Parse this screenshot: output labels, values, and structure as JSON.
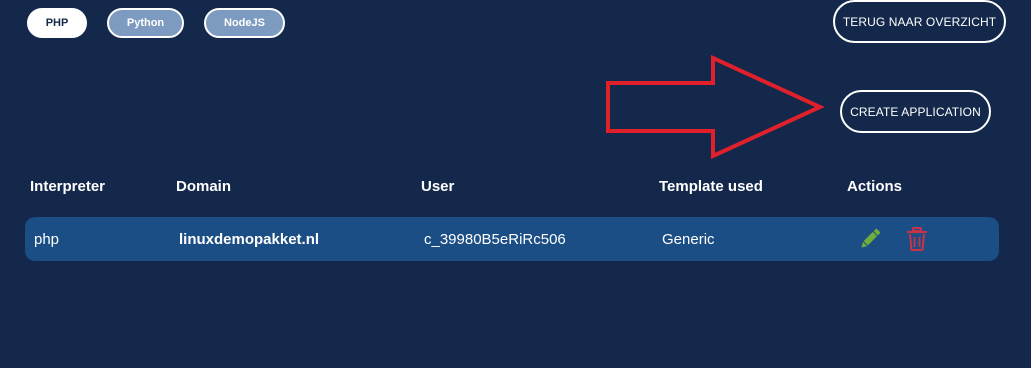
{
  "tabs": [
    {
      "label": "PHP",
      "active": true
    },
    {
      "label": "Python",
      "active": false
    },
    {
      "label": "NodeJS",
      "active": false
    }
  ],
  "back_button": {
    "label": "TERUG NAAR OVERZICHT"
  },
  "create_button": {
    "label": "CREATE APPLICATION"
  },
  "table": {
    "headers": [
      "Interpreter",
      "Domain",
      "User",
      "Template used",
      "Actions"
    ],
    "rows": [
      {
        "interpreter": "php",
        "domain": "linuxdemopakket.nl",
        "user": "c_39980B5eRiRc506",
        "template": "Generic",
        "actions": [
          "pencil-icon",
          "trash-icon"
        ]
      }
    ]
  },
  "colors": {
    "background": "#13284a",
    "row_background": "#1b4e84",
    "edit_icon": "#6fae3c",
    "delete_icon": "#c8334a",
    "annotation_arrow": "#e0212b"
  }
}
